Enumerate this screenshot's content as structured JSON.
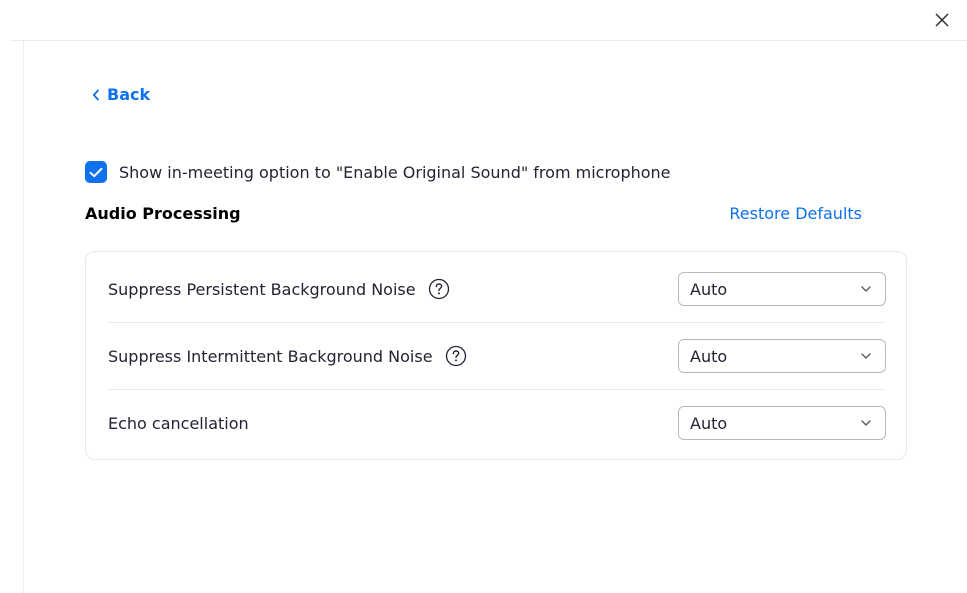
{
  "window": {
    "close_icon": "close-icon"
  },
  "nav": {
    "back_label": "Back",
    "back_icon": "chevron-left-icon"
  },
  "options": {
    "original_sound": {
      "label": "Show in-meeting option to \"Enable Original Sound\" from microphone",
      "checked": true
    }
  },
  "audio_processing": {
    "title": "Audio Processing",
    "restore_label": "Restore Defaults",
    "settings": [
      {
        "label": "Suppress Persistent Background Noise",
        "has_help": true,
        "value": "Auto"
      },
      {
        "label": "Suppress Intermittent Background Noise",
        "has_help": true,
        "value": "Auto"
      },
      {
        "label": "Echo cancellation",
        "has_help": false,
        "value": "Auto"
      }
    ]
  },
  "colors": {
    "accent": "#0e72ed",
    "text": "#232333",
    "border": "#e6e6ec"
  }
}
